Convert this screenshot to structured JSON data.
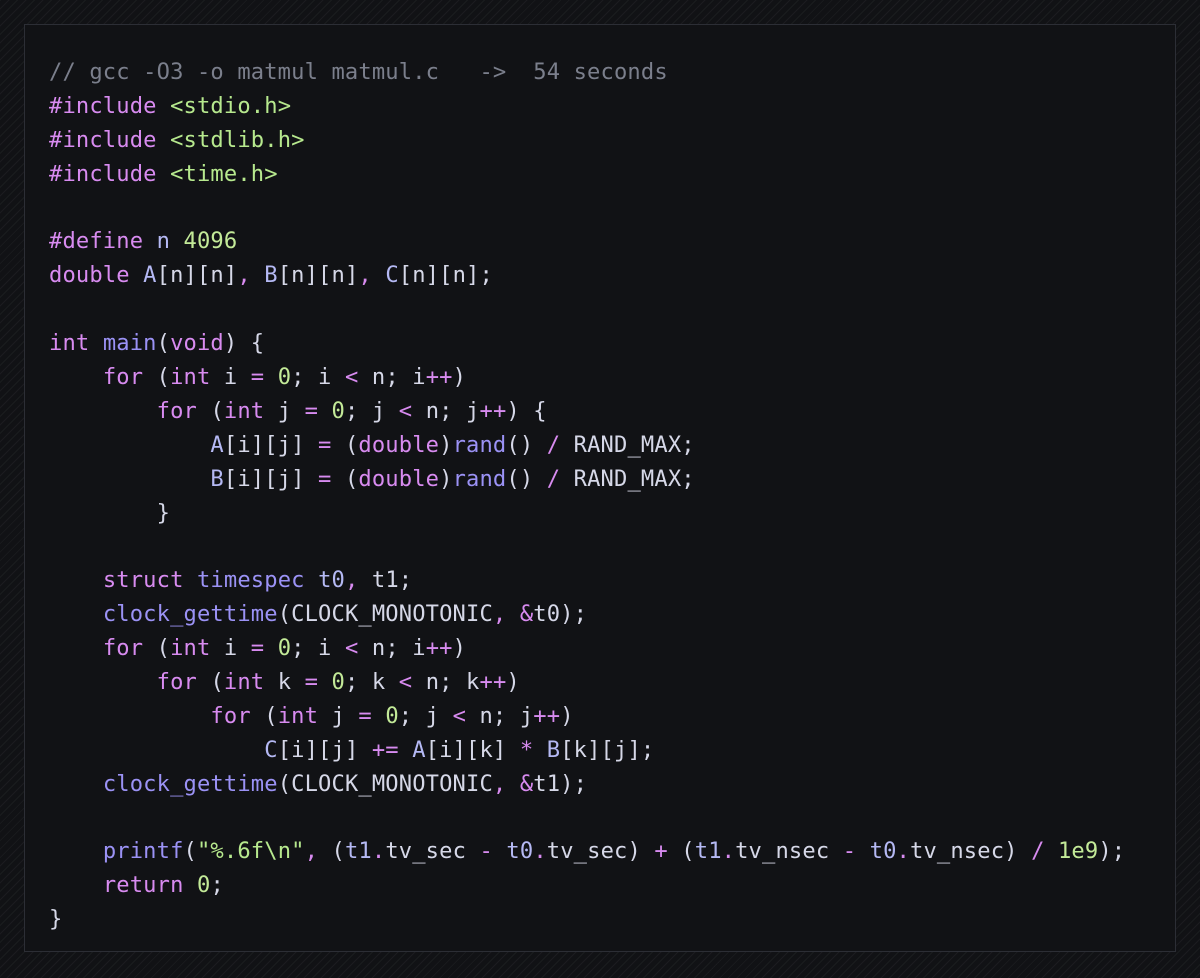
{
  "code": {
    "lines": [
      [
        [
          "// gcc -O3 -o matmul matmul.c   ->  54 seconds",
          "comment"
        ]
      ],
      [
        [
          "#include ",
          "kw"
        ],
        [
          "<stdio.h>",
          "str"
        ]
      ],
      [
        [
          "#include ",
          "kw"
        ],
        [
          "<stdlib.h>",
          "str"
        ]
      ],
      [
        [
          "#include ",
          "kw"
        ],
        [
          "<time.h>",
          "str"
        ]
      ],
      [],
      [
        [
          "#define ",
          "kw"
        ],
        [
          "n ",
          "id"
        ],
        [
          "4096",
          "num"
        ]
      ],
      [
        [
          "double ",
          "kw"
        ],
        [
          "A",
          "id"
        ],
        [
          "[n][n]",
          "punct"
        ],
        [
          ", ",
          "kw"
        ],
        [
          "B",
          "id"
        ],
        [
          "[n][n]",
          "punct"
        ],
        [
          ", ",
          "kw"
        ],
        [
          "C",
          "id"
        ],
        [
          "[n][n];",
          "punct"
        ]
      ],
      [],
      [
        [
          "int ",
          "kw"
        ],
        [
          "main",
          "fn"
        ],
        [
          "(",
          "punct"
        ],
        [
          "void",
          "kw"
        ],
        [
          ") {",
          "punct"
        ]
      ],
      [
        [
          "    ",
          "plain"
        ],
        [
          "for ",
          "kw"
        ],
        [
          "(",
          "punct"
        ],
        [
          "int ",
          "kw"
        ],
        [
          "i ",
          "plain"
        ],
        [
          "= ",
          "kw"
        ],
        [
          "0",
          "num"
        ],
        [
          "; i ",
          "plain"
        ],
        [
          "< ",
          "kw"
        ],
        [
          "n; i",
          "plain"
        ],
        [
          "++",
          "kw"
        ],
        [
          ")",
          "punct"
        ]
      ],
      [
        [
          "        ",
          "plain"
        ],
        [
          "for ",
          "kw"
        ],
        [
          "(",
          "punct"
        ],
        [
          "int ",
          "kw"
        ],
        [
          "j ",
          "plain"
        ],
        [
          "= ",
          "kw"
        ],
        [
          "0",
          "num"
        ],
        [
          "; j ",
          "plain"
        ],
        [
          "< ",
          "kw"
        ],
        [
          "n; j",
          "plain"
        ],
        [
          "++",
          "kw"
        ],
        [
          ") {",
          "punct"
        ]
      ],
      [
        [
          "            ",
          "plain"
        ],
        [
          "A",
          "id"
        ],
        [
          "[i][j] ",
          "punct"
        ],
        [
          "= ",
          "kw"
        ],
        [
          "(",
          "punct"
        ],
        [
          "double",
          "kw"
        ],
        [
          ")",
          "punct"
        ],
        [
          "rand",
          "fn"
        ],
        [
          "() ",
          "punct"
        ],
        [
          "/ ",
          "kw"
        ],
        [
          "RAND_MAX;",
          "plain"
        ]
      ],
      [
        [
          "            ",
          "plain"
        ],
        [
          "B",
          "id"
        ],
        [
          "[i][j] ",
          "punct"
        ],
        [
          "= ",
          "kw"
        ],
        [
          "(",
          "punct"
        ],
        [
          "double",
          "kw"
        ],
        [
          ")",
          "punct"
        ],
        [
          "rand",
          "fn"
        ],
        [
          "() ",
          "punct"
        ],
        [
          "/ ",
          "kw"
        ],
        [
          "RAND_MAX;",
          "plain"
        ]
      ],
      [
        [
          "        }",
          "punct"
        ]
      ],
      [],
      [
        [
          "    ",
          "plain"
        ],
        [
          "struct ",
          "kw"
        ],
        [
          "timespec ",
          "fn"
        ],
        [
          "t0",
          "id"
        ],
        [
          ", ",
          "kw"
        ],
        [
          "t1;",
          "plain"
        ]
      ],
      [
        [
          "    ",
          "plain"
        ],
        [
          "clock_gettime",
          "fn"
        ],
        [
          "(CLOCK_MONOTONIC",
          "plain"
        ],
        [
          ", ",
          "kw"
        ],
        [
          "&",
          "kw"
        ],
        [
          "t0);",
          "plain"
        ]
      ],
      [
        [
          "    ",
          "plain"
        ],
        [
          "for ",
          "kw"
        ],
        [
          "(",
          "punct"
        ],
        [
          "int ",
          "kw"
        ],
        [
          "i ",
          "plain"
        ],
        [
          "= ",
          "kw"
        ],
        [
          "0",
          "num"
        ],
        [
          "; i ",
          "plain"
        ],
        [
          "< ",
          "kw"
        ],
        [
          "n; i",
          "plain"
        ],
        [
          "++",
          "kw"
        ],
        [
          ")",
          "punct"
        ]
      ],
      [
        [
          "        ",
          "plain"
        ],
        [
          "for ",
          "kw"
        ],
        [
          "(",
          "punct"
        ],
        [
          "int ",
          "kw"
        ],
        [
          "k ",
          "plain"
        ],
        [
          "= ",
          "kw"
        ],
        [
          "0",
          "num"
        ],
        [
          "; k ",
          "plain"
        ],
        [
          "< ",
          "kw"
        ],
        [
          "n; k",
          "plain"
        ],
        [
          "++",
          "kw"
        ],
        [
          ")",
          "punct"
        ]
      ],
      [
        [
          "            ",
          "plain"
        ],
        [
          "for ",
          "kw"
        ],
        [
          "(",
          "punct"
        ],
        [
          "int ",
          "kw"
        ],
        [
          "j ",
          "plain"
        ],
        [
          "= ",
          "kw"
        ],
        [
          "0",
          "num"
        ],
        [
          "; j ",
          "plain"
        ],
        [
          "< ",
          "kw"
        ],
        [
          "n; j",
          "plain"
        ],
        [
          "++",
          "kw"
        ],
        [
          ")",
          "punct"
        ]
      ],
      [
        [
          "                ",
          "plain"
        ],
        [
          "C",
          "id"
        ],
        [
          "[i][j] ",
          "punct"
        ],
        [
          "+= ",
          "kw"
        ],
        [
          "A",
          "id"
        ],
        [
          "[i][k] ",
          "punct"
        ],
        [
          "* ",
          "kw"
        ],
        [
          "B",
          "id"
        ],
        [
          "[k][j];",
          "punct"
        ]
      ],
      [
        [
          "    ",
          "plain"
        ],
        [
          "clock_gettime",
          "fn"
        ],
        [
          "(CLOCK_MONOTONIC",
          "plain"
        ],
        [
          ", ",
          "kw"
        ],
        [
          "&",
          "kw"
        ],
        [
          "t1);",
          "plain"
        ]
      ],
      [],
      [
        [
          "    ",
          "plain"
        ],
        [
          "printf",
          "fn"
        ],
        [
          "(",
          "punct"
        ],
        [
          "\"%.6f\\n\"",
          "str"
        ],
        [
          ", ",
          "kw"
        ],
        [
          "(",
          "punct"
        ],
        [
          "t1",
          "id"
        ],
        [
          ".",
          "kw"
        ],
        [
          "tv_sec ",
          "plain"
        ],
        [
          "- ",
          "kw"
        ],
        [
          "t0",
          "id"
        ],
        [
          ".",
          "kw"
        ],
        [
          "tv_sec) ",
          "plain"
        ],
        [
          "+ ",
          "kw"
        ],
        [
          "(",
          "punct"
        ],
        [
          "t1",
          "id"
        ],
        [
          ".",
          "kw"
        ],
        [
          "tv_nsec ",
          "plain"
        ],
        [
          "- ",
          "kw"
        ],
        [
          "t0",
          "id"
        ],
        [
          ".",
          "kw"
        ],
        [
          "tv_nsec) ",
          "plain"
        ],
        [
          "/ ",
          "kw"
        ],
        [
          "1e9",
          "num"
        ],
        [
          ");",
          "punct"
        ]
      ],
      [
        [
          "    ",
          "plain"
        ],
        [
          "return ",
          "kw"
        ],
        [
          "0",
          "num"
        ],
        [
          ";",
          "punct"
        ]
      ],
      [
        [
          "}",
          "punct"
        ]
      ]
    ]
  },
  "colors": {
    "background": "#111215",
    "border": "#2c2e35",
    "comment": "#7b7f8c",
    "keyword": "#d88bf0",
    "string": "#b7e98e",
    "number": "#c3ea98",
    "function": "#9b92f5",
    "identifier": "#b5b9f4",
    "text": "#d6d8e8"
  }
}
